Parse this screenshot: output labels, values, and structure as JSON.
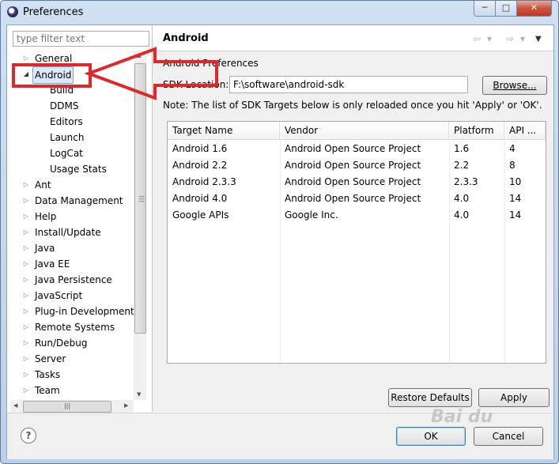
{
  "window": {
    "title": "Preferences",
    "min": "─",
    "max": "□",
    "close": "✕"
  },
  "filter": {
    "placeholder": "type filter text"
  },
  "tree": [
    {
      "label": "General",
      "toggle": "▷"
    },
    {
      "label": "Android",
      "toggle": "◢"
    },
    {
      "label": "Build",
      "toggle": ""
    },
    {
      "label": "DDMS",
      "toggle": ""
    },
    {
      "label": "Editors",
      "toggle": ""
    },
    {
      "label": "Launch",
      "toggle": ""
    },
    {
      "label": "LogCat",
      "toggle": ""
    },
    {
      "label": "Usage Stats",
      "toggle": ""
    },
    {
      "label": "Ant",
      "toggle": "▷"
    },
    {
      "label": "Data Management",
      "toggle": "▷"
    },
    {
      "label": "Help",
      "toggle": "▷"
    },
    {
      "label": "Install/Update",
      "toggle": "▷"
    },
    {
      "label": "Java",
      "toggle": "▷"
    },
    {
      "label": "Java EE",
      "toggle": "▷"
    },
    {
      "label": "Java Persistence",
      "toggle": "▷"
    },
    {
      "label": "JavaScript",
      "toggle": "▷"
    },
    {
      "label": "Plug-in Development",
      "toggle": "▷"
    },
    {
      "label": "Remote Systems",
      "toggle": "▷"
    },
    {
      "label": "Run/Debug",
      "toggle": "▷"
    },
    {
      "label": "Server",
      "toggle": "▷"
    },
    {
      "label": "Tasks",
      "toggle": "▷"
    },
    {
      "label": "Team",
      "toggle": "▷"
    }
  ],
  "page": {
    "title": "Android",
    "nav_back": "⇦",
    "nav_back_menu": "▾",
    "nav_fwd": "⇨",
    "nav_fwd_menu": "▾",
    "view_menu": "▼",
    "preferences_label": "Android Preferences",
    "sdk_label": "SDK Location:",
    "sdk_value": "F:\\software\\android-sdk",
    "browse_label": "Browse...",
    "note": "Note: The list of SDK Targets below is only reloaded once you hit 'Apply' or 'OK'.",
    "table": {
      "headers": [
        "Target Name",
        "Vendor",
        "Platform",
        "API ..."
      ],
      "rows": [
        [
          "Android 1.6",
          "Android Open Source Project",
          "1.6",
          "4"
        ],
        [
          "Android 2.2",
          "Android Open Source Project",
          "2.2",
          "8"
        ],
        [
          "Android 2.3.3",
          "Android Open Source Project",
          "2.3.3",
          "10"
        ],
        [
          "Android 4.0",
          "Android Open Source Project",
          "4.0",
          "14"
        ],
        [
          "Google APIs",
          "Google Inc.",
          "4.0",
          "14"
        ]
      ]
    },
    "restore_label": "Restore Defaults",
    "apply_label": "Apply"
  },
  "footer": {
    "help": "?",
    "ok_label": "OK",
    "cancel_label": "Cancel"
  },
  "watermark": "Bai du",
  "colors": {
    "callout": "#e0282c",
    "selection": "#dbe9fb"
  }
}
